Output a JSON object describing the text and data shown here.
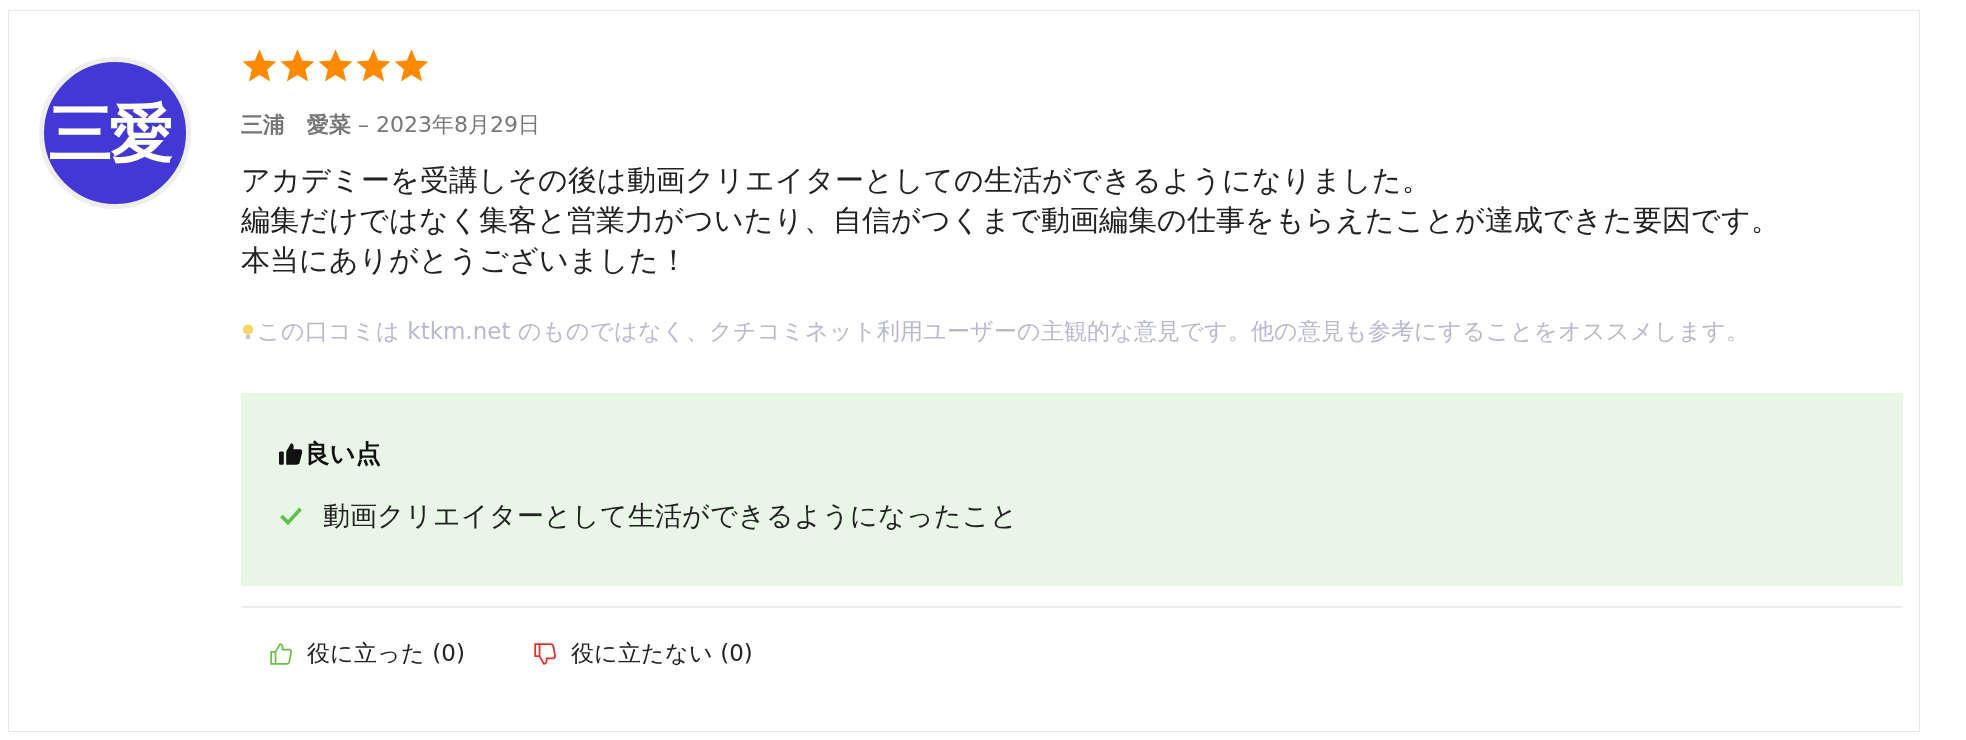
{
  "review": {
    "avatar_text": "三愛",
    "stars": 5,
    "author": "三浦　愛菜",
    "date": "– 2023年8月29日",
    "body": [
      "アカデミーを受講しその後は動画クリエイターとしての生活ができるようになりました。",
      "編集だけではなく集客と営業力がついたり、自信がつくまで動画編集の仕事をもらえたことが達成できた要因です。",
      "本当にありがとうございました！"
    ],
    "disclaimer": "この口コミは ktkm.net のものではなく、クチコミネット利用ユーザーの主観的な意見です。他の意見も参考にすることをオススメします。",
    "good_points": {
      "title": "良い点",
      "items": [
        "動画クリエイターとして生活ができるようになったこと"
      ]
    },
    "votes": [
      {
        "kind": "helpful",
        "label": "役に立った (0)"
      },
      {
        "kind": "unhelpful",
        "label": "役に立たない (0)"
      }
    ]
  }
}
